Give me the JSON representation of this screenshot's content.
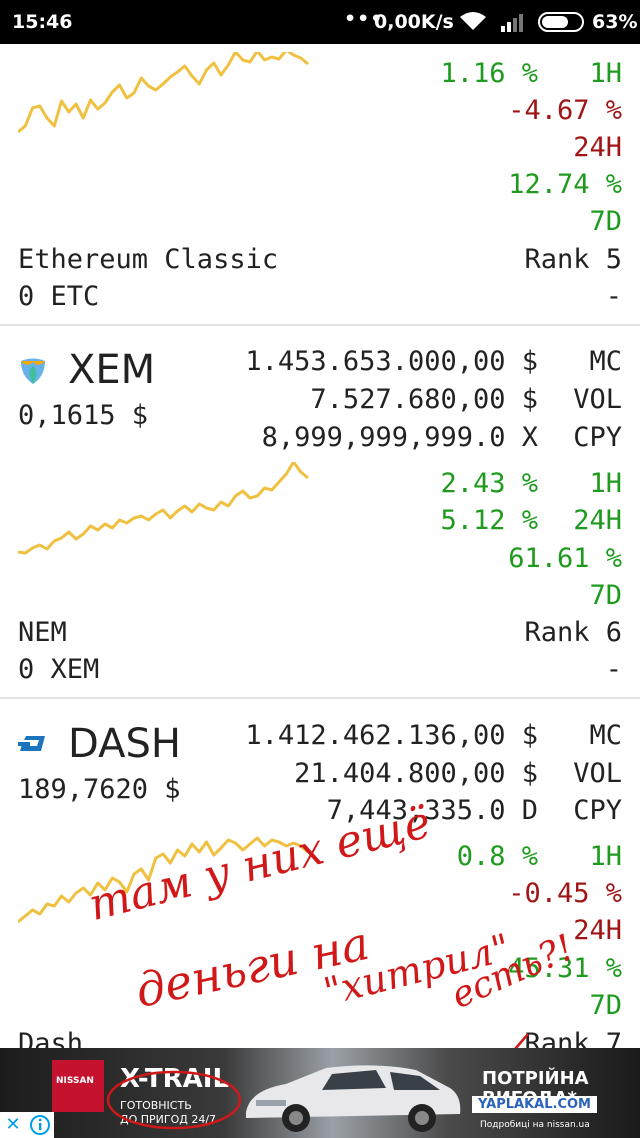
{
  "status_bar": {
    "time": "15:46",
    "network_speed": "0,00K/s",
    "battery": "63%"
  },
  "coins": [
    {
      "id": "etc",
      "name": "Ethereum Classic",
      "holdings": "0 ETC",
      "rank": "Rank 5",
      "value": "-",
      "changes": {
        "1h": "1.16 %",
        "1h_label": "1H",
        "24h": "-4.67 %",
        "24h_label": "24H",
        "7d": "12.74 %",
        "7d_label": "7D"
      }
    },
    {
      "id": "xem",
      "symbol": "XEM",
      "price": "0,1615 $",
      "market_cap": "1.453.653.000,00 $",
      "mc_label": "MC",
      "volume": "7.527.680,00 $",
      "vol_label": "VOL",
      "supply": "8,999,999,999.0 X",
      "cpy_label": "CPY",
      "name": "NEM",
      "holdings": "0 XEM",
      "rank": "Rank 6",
      "value": "-",
      "changes": {
        "1h": "2.43 %",
        "1h_label": "1H",
        "24h": "5.12 %",
        "24h_label": "24H",
        "7d": "61.61 %",
        "7d_label": "7D"
      }
    },
    {
      "id": "dash",
      "symbol": "DASH",
      "price": "189,7620 $",
      "market_cap": "1.412.462.136,00 $",
      "mc_label": "MC",
      "volume": "21.404.800,00 $",
      "vol_label": "VOL",
      "supply": "7,443,335.0 D",
      "cpy_label": "CPY",
      "name": "Dash",
      "rank": "Rank 7",
      "changes": {
        "1h": "0.8 %",
        "1h_label": "1H",
        "24h": "-0.45 %",
        "24h_label": "24H",
        "7d": "45.31 %",
        "7d_label": "7D"
      }
    }
  ],
  "handwriting": {
    "line1": "там у них ещё",
    "line2": "деньги на",
    "line3": "\"хитрил\"",
    "line4": "есть?!"
  },
  "ad": {
    "brand": "NISSAN",
    "title": "X-TRAIL",
    "subtitle_line1": "ГОТОВНІСТЬ",
    "subtitle_line2": "ДО ПРИГОД 24/7",
    "promo_line1": "ПОТРІЙНА",
    "promo_line2": "ВИГОДА*",
    "promo_small": "Подробиці на nissan.ua",
    "watermark": "YAPLAKAL.COM"
  },
  "colors": {
    "positive": "#1e9b1e",
    "negative": "#a01616",
    "sparkline": "#f0c040",
    "annotation": "#d01818"
  },
  "sparklines": {
    "etc": [
      24,
      30,
      48,
      50,
      38,
      30,
      55,
      44,
      52,
      38,
      56,
      47,
      53,
      64,
      71,
      58,
      63,
      78,
      70,
      66,
      72,
      79,
      84,
      90,
      80,
      72,
      86,
      93,
      81,
      91,
      104,
      96,
      94,
      105,
      96,
      99,
      97,
      106,
      101,
      98,
      92
    ],
    "xem": [
      14,
      13,
      18,
      21,
      17,
      25,
      28,
      34,
      27,
      32,
      40,
      36,
      42,
      38,
      46,
      43,
      48,
      50,
      46,
      52,
      56,
      48,
      55,
      60,
      54,
      62,
      58,
      56,
      64,
      60,
      70,
      75,
      68,
      70,
      78,
      76,
      84,
      92,
      104,
      94,
      88
    ],
    "dash": [
      18,
      24,
      30,
      26,
      36,
      34,
      44,
      38,
      47,
      52,
      45,
      57,
      50,
      62,
      58,
      48,
      66,
      71,
      60,
      82,
      86,
      77,
      90,
      84,
      96,
      88,
      98,
      85,
      92,
      100,
      97,
      90,
      96,
      102,
      94,
      100,
      98,
      94,
      97,
      94,
      88
    ]
  }
}
